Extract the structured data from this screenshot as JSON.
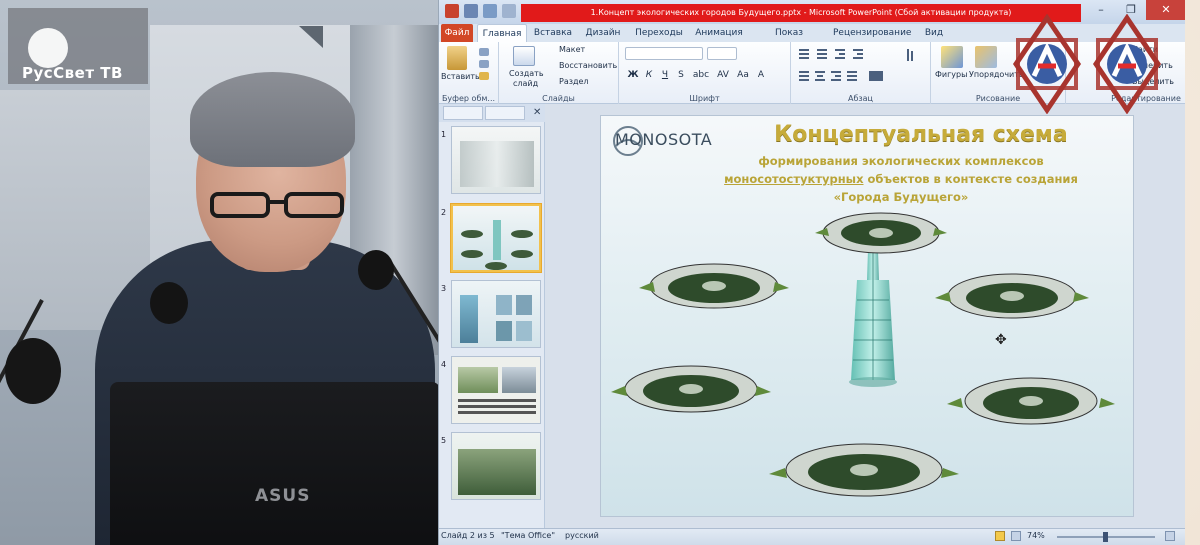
{
  "channel": {
    "name": "РусСвет ТВ"
  },
  "laptop": {
    "brand": "ASUS"
  },
  "window": {
    "title": "1.Концепт экологических городов Будущего.pptx - Microsoft PowerPoint (Сбой активации продукта)",
    "controls": [
      "–",
      "❐",
      "✕"
    ]
  },
  "tabs": [
    {
      "label": "Файл"
    },
    {
      "label": "Главная"
    },
    {
      "label": "Вставка"
    },
    {
      "label": "Дизайн"
    },
    {
      "label": "Переходы"
    },
    {
      "label": "Анимация"
    },
    {
      "label": "Показ слайдов"
    },
    {
      "label": "Рецензирование"
    },
    {
      "label": "Вид"
    }
  ],
  "ribbon": {
    "clipboard": {
      "paste": "Вставить",
      "label": "Буфер обм..."
    },
    "slides": {
      "create": "Создать",
      "create2": "слайд",
      "layout": "Макет",
      "reset": "Восстановить",
      "section": "Раздел",
      "label": "Слайды"
    },
    "font": {
      "label": "Шрифт",
      "buttons": [
        "Ж",
        "К",
        "Ч",
        "S",
        "abc",
        "AV",
        "Aa",
        "A"
      ]
    },
    "paragraph": {
      "label": "Абзац"
    },
    "drawing": {
      "shapes": "Фигуры",
      "arrange": "Упорядочить",
      "label": "Рисование"
    },
    "editing": {
      "find": "Найти",
      "replace": "Заменить",
      "select": "Выделить",
      "label": "Редактирование"
    }
  },
  "thumbnails": [
    {
      "num": "1"
    },
    {
      "num": "2"
    },
    {
      "num": "3"
    },
    {
      "num": "4"
    },
    {
      "num": "5"
    }
  ],
  "slide": {
    "logo": "MONOSOTA",
    "title": "Концептуальная схема",
    "subtitle_line1": "формирования экологических комплексов",
    "subtitle_line2_u": "моносотостуктурных",
    "subtitle_line2": " объектов в контексте создания",
    "subtitle_line3": "«Города Будущего»"
  },
  "status": {
    "slide": "Слайд 2 из 5",
    "theme": "\"Тема Office\"",
    "lang": "русский",
    "zoom": "74%"
  },
  "colors": {
    "title_gold": "#c6ab3a",
    "file_tab": "#d24726",
    "title_red": "#e11a1a"
  }
}
